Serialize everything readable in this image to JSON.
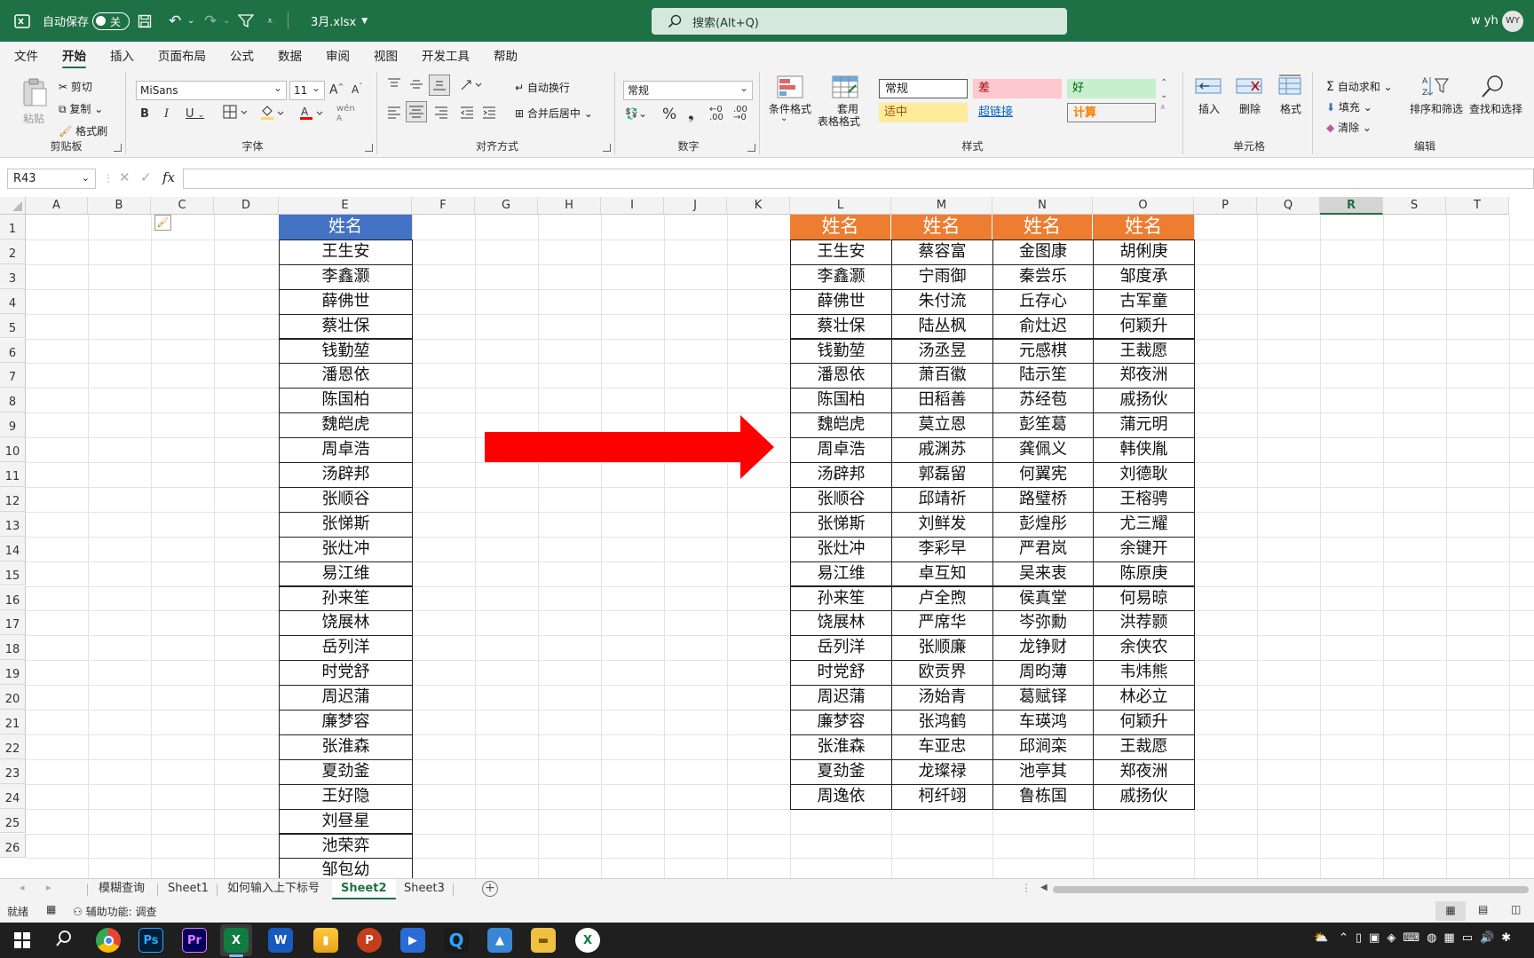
{
  "titlebar": {
    "autosave_label": "自动保存",
    "autosave_state": "关",
    "filename": "3月.xlsx",
    "search_placeholder": "搜索(Alt+Q)",
    "user_name": "w yh",
    "user_initials": "WY"
  },
  "menu": [
    "文件",
    "开始",
    "插入",
    "页面布局",
    "公式",
    "数据",
    "审阅",
    "视图",
    "开发工具",
    "帮助"
  ],
  "ribbon": {
    "clipboard": {
      "label": "剪贴板",
      "paste": "粘贴",
      "cut": "剪切",
      "copy": "复制",
      "format_painter": "格式刷"
    },
    "font": {
      "label": "字体",
      "font_name": "MiSans",
      "font_size": "11"
    },
    "alignment": {
      "label": "对齐方式",
      "wrap": "自动换行",
      "merge": "合并后居中"
    },
    "number": {
      "label": "数字",
      "format": "常规"
    },
    "styles": {
      "label": "样式",
      "conditional": "条件格式",
      "table_format_1": "套用",
      "table_format_2": "表格格式",
      "normal": "常规",
      "bad": "差",
      "good": "好",
      "neutral": "适中",
      "hyperlink": "超链接",
      "calc": "计算"
    },
    "cells": {
      "label": "单元格",
      "insert": "插入",
      "delete": "删除",
      "format": "格式"
    },
    "editing": {
      "label": "编辑",
      "autosum": "自动求和",
      "fill": "填充",
      "clear": "清除",
      "sort": "排序和筛选",
      "find": "查找和选择"
    }
  },
  "formula_bar": {
    "name_box": "R43",
    "fx": "fx",
    "content": ""
  },
  "columns": [
    "A",
    "B",
    "C",
    "D",
    "E",
    "F",
    "G",
    "H",
    "I",
    "J",
    "K",
    "L",
    "M",
    "N",
    "O",
    "P",
    "Q",
    "R",
    "S",
    "T"
  ],
  "selected_column": "R",
  "rows": [
    "1",
    "2",
    "3",
    "4",
    "5",
    "6",
    "7",
    "8",
    "9",
    "10",
    "11",
    "12",
    "13",
    "14",
    "15",
    "16",
    "17",
    "18",
    "19",
    "20",
    "21",
    "22",
    "23",
    "24",
    "25",
    "26"
  ],
  "table_e": {
    "header": "姓名",
    "names": [
      "王生安",
      "李鑫灏",
      "薛佛世",
      "蔡壮保",
      "钱勤堃",
      "潘恩依",
      "陈国柏",
      "魏皑虎",
      "周卓浩",
      "汤辟邦",
      "张顺谷",
      "张悌斯",
      "张灶冲",
      "易江维",
      "孙来笙",
      "饶展林",
      "岳列洋",
      "时党舒",
      "周迟蒲",
      "廉梦容",
      "张淮森",
      "夏劲釜",
      "王好隐",
      "刘昼星",
      "池荣弈",
      "邹包幼"
    ]
  },
  "table_lo": {
    "headers": [
      "姓名",
      "姓名",
      "姓名",
      "姓名"
    ],
    "columns": [
      [
        "王生安",
        "李鑫灏",
        "薛佛世",
        "蔡壮保",
        "钱勤堃",
        "潘恩依",
        "陈国柏",
        "魏皑虎",
        "周卓浩",
        "汤辟邦",
        "张顺谷",
        "张悌斯",
        "张灶冲",
        "易江维",
        "孙来笙",
        "饶展林",
        "岳列洋",
        "时党舒",
        "周迟蒲",
        "廉梦容",
        "张淮森",
        "夏劲釜",
        "周逸依"
      ],
      [
        "蔡容富",
        "宁雨御",
        "朱付流",
        "陆丛枫",
        "汤丞昱",
        "萧百徽",
        "田稻善",
        "莫立恩",
        "戚渊苏",
        "郭磊留",
        "邱靖祈",
        "刘鲜发",
        "李彩早",
        "卓互知",
        "卢全煦",
        "严席华",
        "张顺廉",
        "欧贡界",
        "汤始青",
        "张鸿鹤",
        "车亚忠",
        "龙璨禄",
        "柯纤翊"
      ],
      [
        "金图康",
        "秦尝乐",
        "丘存心",
        "俞灶迟",
        "元感棋",
        "陆示笙",
        "苏经苞",
        "彭笙葛",
        "龚佩义",
        "何翼宪",
        "路璧桥",
        "彭煌彤",
        "严君岚",
        "吴来衷",
        "侯真堂",
        "岑弥勳",
        "龙铮财",
        "周昀薄",
        "葛赋铎",
        "车瑛鸿",
        "邱涧栾",
        "池亭其",
        "鲁栋国"
      ],
      [
        "胡俐庚",
        "邹度承",
        "古军童",
        "何颖升",
        "王裁愿",
        "郑夜洲",
        "戚扬伙",
        "蒲元明",
        "韩侠胤",
        "刘德耿",
        "王榕骋",
        "尤三耀",
        "余键开",
        "陈原庚",
        "何易晾",
        "洪荐颢",
        "余侠农",
        "韦炜熊",
        "林必立",
        "何颖升",
        "王裁愿",
        "郑夜洲",
        "戚扬伙"
      ]
    ]
  },
  "arrow_color": "#ff0000",
  "sheets": [
    "模糊查询",
    "Sheet1",
    "如何输入上下标号",
    "Sheet2",
    "Sheet3"
  ],
  "active_sheet": "Sheet2",
  "status": {
    "ready": "就绪",
    "accessibility": "辅助功能: 调查"
  },
  "taskbar_apps": [
    "Chrome",
    "Ps",
    "Pr",
    "Excel",
    "Word",
    "Files",
    "PowerPoint",
    "Video",
    "Q",
    "Photos",
    "Explorer",
    "Excel"
  ]
}
